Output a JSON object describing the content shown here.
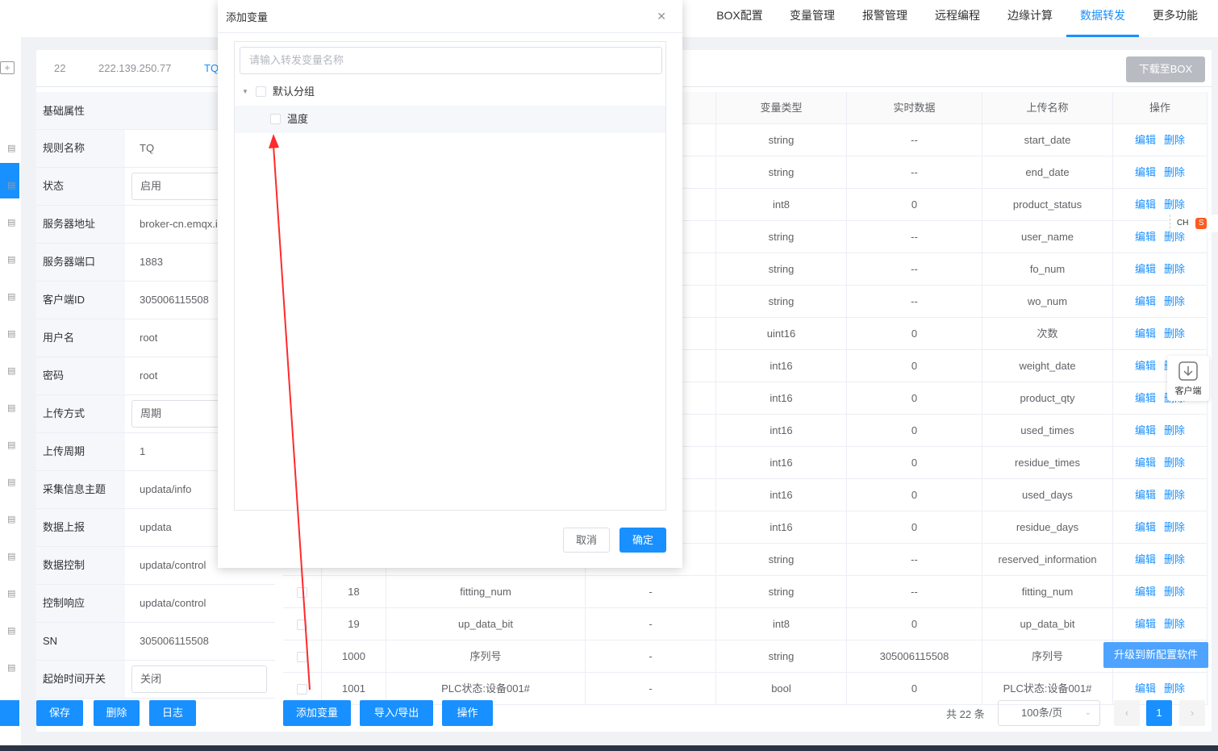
{
  "nav": [
    "BOX配置",
    "变量管理",
    "报警管理",
    "远程编程",
    "边缘计算",
    "数据转发",
    "更多功能"
  ],
  "tabs": {
    "first": "22",
    "ip": "222.139.250.77",
    "name": "TQ"
  },
  "download_button": "下载至BOX",
  "props": {
    "header": "基础属性",
    "rows": [
      {
        "k": "规则名称",
        "v": "TQ",
        "type": "text"
      },
      {
        "k": "状态",
        "v": "启用",
        "type": "select"
      },
      {
        "k": "服务器地址",
        "v": "broker-cn.emqx.i",
        "type": "text"
      },
      {
        "k": "服务器端口",
        "v": "1883",
        "type": "text"
      },
      {
        "k": "客户端ID",
        "v": "305006115508",
        "type": "text"
      },
      {
        "k": "用户名",
        "v": "root",
        "type": "text"
      },
      {
        "k": "密码",
        "v": "root",
        "type": "text"
      },
      {
        "k": "上传方式",
        "v": "周期",
        "type": "select"
      },
      {
        "k": "上传周期",
        "v": "1",
        "type": "text"
      },
      {
        "k": "采集信息主题",
        "v": "updata/info",
        "type": "text"
      },
      {
        "k": "数据上报",
        "v": "updata",
        "type": "text"
      },
      {
        "k": "数据控制",
        "v": "updata/control",
        "type": "text"
      },
      {
        "k": "控制响应",
        "v": "updata/control",
        "type": "text"
      },
      {
        "k": "SN",
        "v": "305006115508",
        "type": "text"
      },
      {
        "k": "起始时间开关",
        "v": "关闭",
        "type": "select"
      }
    ]
  },
  "table": {
    "headers": [
      "",
      "",
      "",
      "",
      "变量类型",
      "实时数据",
      "上传名称",
      "操作"
    ],
    "rows": [
      {
        "id": "",
        "name": "",
        "dash": "",
        "type": "string",
        "rt": "--",
        "up": "start_date"
      },
      {
        "id": "",
        "name": "",
        "dash": "",
        "type": "string",
        "rt": "--",
        "up": "end_date"
      },
      {
        "id": "",
        "name": "",
        "dash": "",
        "type": "int8",
        "rt": "0",
        "up": "product_status"
      },
      {
        "id": "",
        "name": "",
        "dash": "",
        "type": "string",
        "rt": "--",
        "up": "user_name"
      },
      {
        "id": "",
        "name": "",
        "dash": "",
        "type": "string",
        "rt": "--",
        "up": "fo_num"
      },
      {
        "id": "",
        "name": "",
        "dash": "",
        "type": "string",
        "rt": "--",
        "up": "wo_num"
      },
      {
        "id": "",
        "name": "",
        "dash": "",
        "type": "uint16",
        "rt": "0",
        "up": "次数"
      },
      {
        "id": "",
        "name": "",
        "dash": "",
        "type": "int16",
        "rt": "0",
        "up": "weight_date"
      },
      {
        "id": "",
        "name": "",
        "dash": "",
        "type": "int16",
        "rt": "0",
        "up": "product_qty"
      },
      {
        "id": "",
        "name": "",
        "dash": "",
        "type": "int16",
        "rt": "0",
        "up": "used_times"
      },
      {
        "id": "",
        "name": "",
        "dash": "",
        "type": "int16",
        "rt": "0",
        "up": "residue_times"
      },
      {
        "id": "",
        "name": "",
        "dash": "",
        "type": "int16",
        "rt": "0",
        "up": "used_days"
      },
      {
        "id": "",
        "name": "",
        "dash": "",
        "type": "int16",
        "rt": "0",
        "up": "residue_days"
      },
      {
        "id": "",
        "name": "",
        "dash": "",
        "type": "string",
        "rt": "--",
        "up": "reserved_information"
      },
      {
        "id": "18",
        "name": "fitting_num",
        "dash": "-",
        "type": "string",
        "rt": "--",
        "up": "fitting_num"
      },
      {
        "id": "19",
        "name": "up_data_bit",
        "dash": "-",
        "type": "int8",
        "rt": "0",
        "up": "up_data_bit"
      },
      {
        "id": "1000",
        "name": "序列号",
        "dash": "-",
        "type": "string",
        "rt": "305006115508",
        "up": "序列号"
      },
      {
        "id": "1001",
        "name": "PLC状态:设备001#",
        "dash": "-",
        "type": "bool",
        "rt": "0",
        "up": "PLC状态:设备001#"
      }
    ],
    "edit": "编辑",
    "delete": "删除"
  },
  "bottom": {
    "save": "保存",
    "remove": "删除",
    "log": "日志",
    "add_var": "添加变量",
    "import_export": "导入/导出",
    "ops": "操作",
    "total": "共 22 条",
    "page_size": "100条/页",
    "page": "1"
  },
  "upgrade": "升级到新配置软件",
  "client": "客户端",
  "ime": "CH",
  "modal": {
    "title": "添加变量",
    "search_placeholder": "请输入转发变量名称",
    "group": "默认分组",
    "item": "温度",
    "cancel": "取消",
    "ok": "确定"
  },
  "colors": {
    "primary": "#1890ff",
    "annotation_arrow": "#ff2a2a"
  }
}
